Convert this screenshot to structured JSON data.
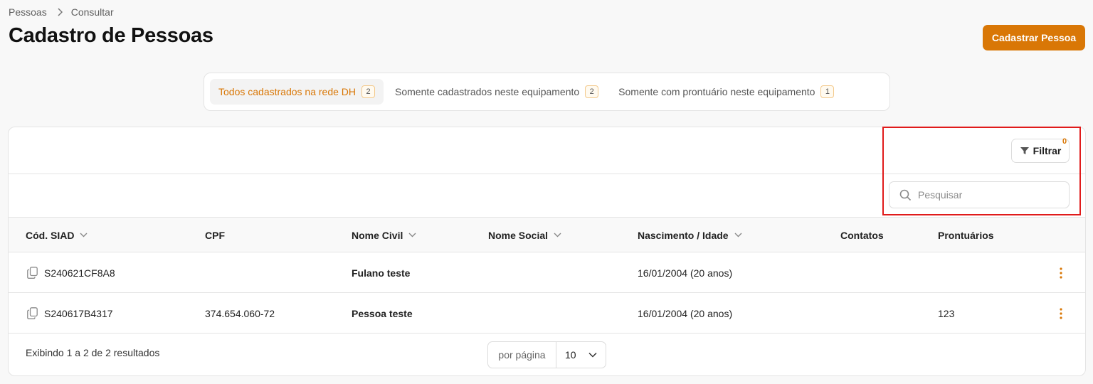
{
  "breadcrumb": {
    "items": [
      "Pessoas",
      "Consultar"
    ]
  },
  "page": {
    "title": "Cadastro de Pessoas",
    "primary_button": "Cadastrar Pessoa"
  },
  "tabs": [
    {
      "label": "Todos cadastrados na rede DH",
      "count": "2",
      "active": true
    },
    {
      "label": "Somente cadastrados neste equipamento",
      "count": "2",
      "active": false
    },
    {
      "label": "Somente com prontuário neste equipamento",
      "count": "1",
      "active": false
    }
  ],
  "toolbar": {
    "filter_label": "Filtrar",
    "filter_count": "0"
  },
  "search": {
    "placeholder": "Pesquisar"
  },
  "table": {
    "columns": [
      "Cód. SIAD",
      "CPF",
      "Nome Civil",
      "Nome Social",
      "Nascimento / Idade",
      "Contatos",
      "Prontuários"
    ],
    "rows": [
      {
        "cod": "S240621CF8A8",
        "cpf": "",
        "nome_civil": "Fulano teste",
        "nome_social": "",
        "nascimento": "16/01/2004 (20 anos)",
        "contatos": "",
        "prontuarios": ""
      },
      {
        "cod": "S240617B4317",
        "cpf": "374.654.060-72",
        "nome_civil": "Pessoa teste",
        "nome_social": "",
        "nascimento": "16/01/2004 (20 anos)",
        "contatos": "",
        "prontuarios": "123"
      }
    ]
  },
  "footer": {
    "summary": "Exibindo 1 a 2 de 2 resultados",
    "per_page_label": "por página",
    "per_page_value": "10"
  },
  "colors": {
    "accent": "#d97706",
    "highlight": "#e01b1b"
  },
  "icons": [
    "chevron-right-icon",
    "filter-icon",
    "search-icon",
    "chevron-down-icon",
    "copy-icon",
    "kebab-menu-icon"
  ]
}
